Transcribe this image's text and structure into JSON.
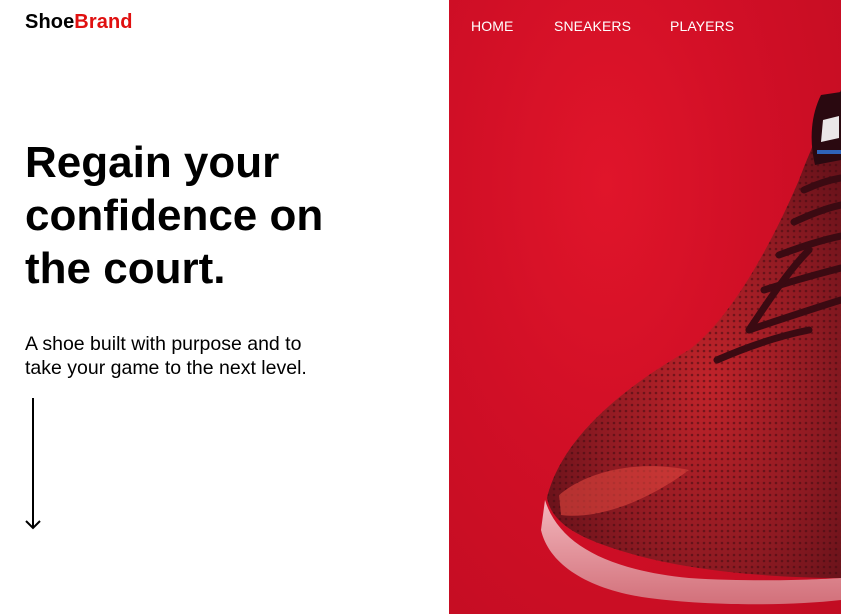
{
  "brand": {
    "part1": "Shoe",
    "part2": "Brand",
    "accent_color": "#e01010"
  },
  "nav": {
    "items": [
      {
        "label": "HOME"
      },
      {
        "label": "SNEAKERS"
      },
      {
        "label": "PLAYERS"
      }
    ]
  },
  "hero": {
    "title_lines": [
      "Regain your",
      "confidence on",
      "the court."
    ],
    "subtitle_lines": [
      "A shoe built with purpose and to",
      "take your game to the next level."
    ],
    "scroll_icon": "arrow-down-icon"
  },
  "image": {
    "subject": "shoe-photo",
    "background_color": "#d10f26"
  }
}
